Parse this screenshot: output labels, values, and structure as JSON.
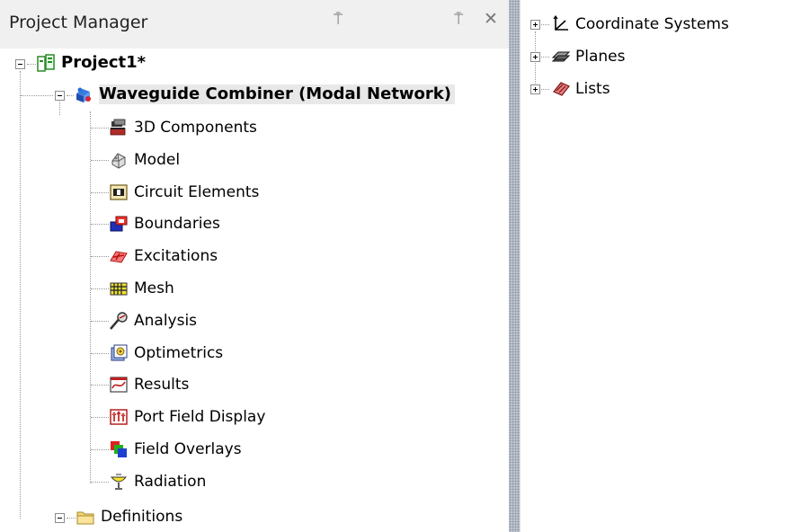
{
  "project_manager": {
    "title": "Project Manager",
    "pin_glyph": "⍑",
    "close_glyph": "✕",
    "project": {
      "label": "Project1*",
      "design": {
        "label": "Waveguide Combiner (Modal Network)",
        "items": [
          {
            "label": "3D Components",
            "icon": "3d-components-icon"
          },
          {
            "label": "Model",
            "icon": "model-icon"
          },
          {
            "label": "Circuit Elements",
            "icon": "circuit-elements-icon"
          },
          {
            "label": "Boundaries",
            "icon": "boundaries-icon"
          },
          {
            "label": "Excitations",
            "icon": "excitations-icon"
          },
          {
            "label": "Mesh",
            "icon": "mesh-icon"
          },
          {
            "label": "Analysis",
            "icon": "analysis-icon"
          },
          {
            "label": "Optimetrics",
            "icon": "optimetrics-icon"
          },
          {
            "label": "Results",
            "icon": "results-icon"
          },
          {
            "label": "Port Field Display",
            "icon": "port-field-display-icon"
          },
          {
            "label": "Field Overlays",
            "icon": "field-overlays-icon"
          },
          {
            "label": "Radiation",
            "icon": "radiation-icon"
          }
        ]
      },
      "definitions": {
        "label": "Definitions"
      }
    }
  },
  "model_tree": {
    "items": [
      {
        "label": "Coordinate Systems",
        "icon": "coordinate-systems-icon"
      },
      {
        "label": "Planes",
        "icon": "planes-icon"
      },
      {
        "label": "Lists",
        "icon": "lists-icon"
      }
    ]
  },
  "colors": {
    "header_bg": "#f0f0f0",
    "splitter": "#c8ccd4",
    "tree_line": "#999999"
  }
}
